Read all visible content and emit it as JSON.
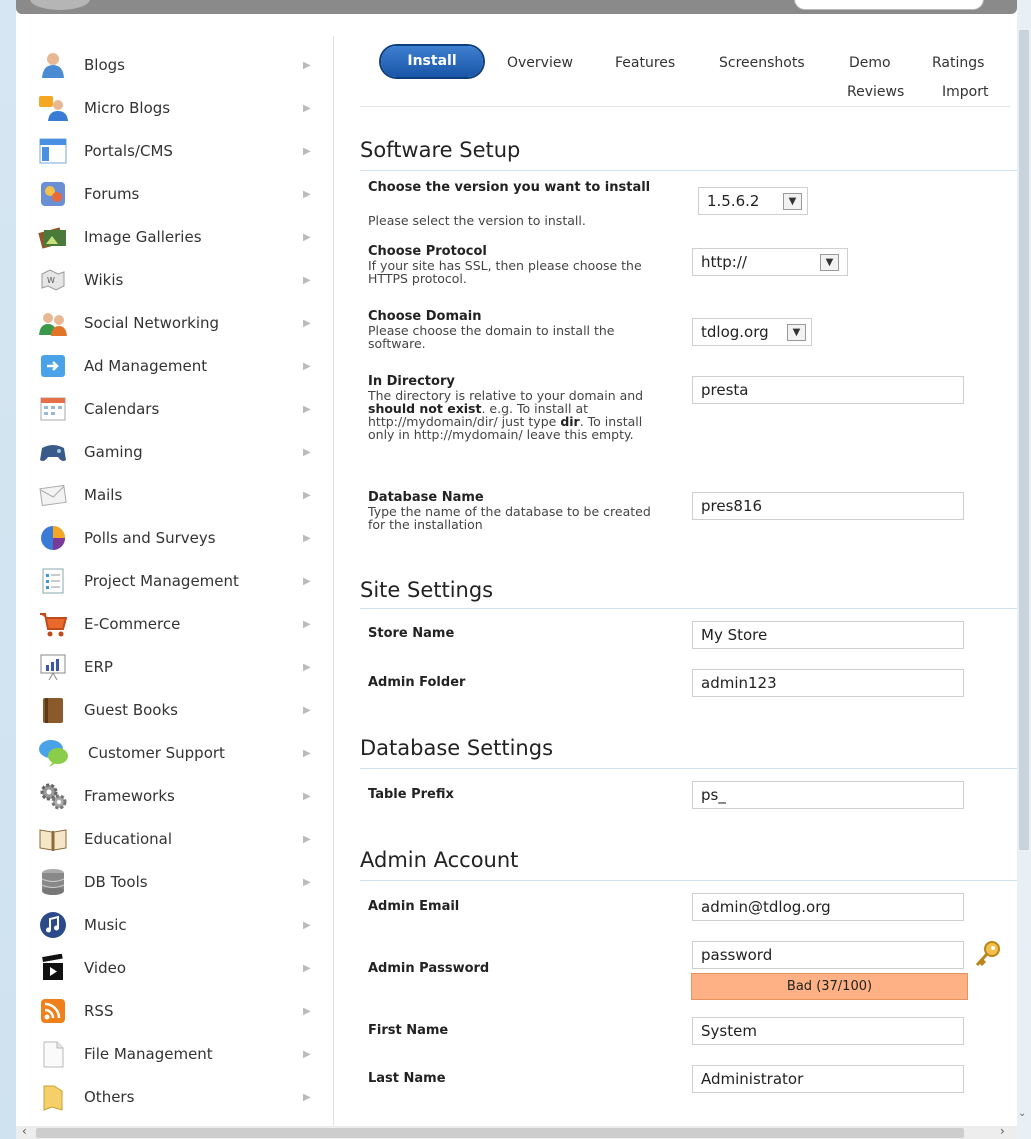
{
  "sidebar": {
    "categories": [
      {
        "label": "Blogs",
        "icon": "blogs-icon"
      },
      {
        "label": "Micro Blogs",
        "icon": "micro-blogs-icon"
      },
      {
        "label": "Portals/CMS",
        "icon": "portals-cms-icon"
      },
      {
        "label": "Forums",
        "icon": "forums-icon"
      },
      {
        "label": "Image Galleries",
        "icon": "image-galleries-icon"
      },
      {
        "label": "Wikis",
        "icon": "wikis-icon"
      },
      {
        "label": "Social Networking",
        "icon": "social-networking-icon"
      },
      {
        "label": "Ad Management",
        "icon": "ad-management-icon"
      },
      {
        "label": "Calendars",
        "icon": "calendars-icon"
      },
      {
        "label": "Gaming",
        "icon": "gaming-icon"
      },
      {
        "label": "Mails",
        "icon": "mails-icon"
      },
      {
        "label": "Polls and Surveys",
        "icon": "polls-icon"
      },
      {
        "label": "Project Management",
        "icon": "project-management-icon"
      },
      {
        "label": "E-Commerce",
        "icon": "cart-icon"
      },
      {
        "label": "ERP",
        "icon": "erp-icon"
      },
      {
        "label": "Guest Books",
        "icon": "guest-books-icon"
      },
      {
        "label": "Customer Support",
        "icon": "customer-support-icon"
      },
      {
        "label": "Frameworks",
        "icon": "gears-icon"
      },
      {
        "label": "Educational",
        "icon": "book-icon"
      },
      {
        "label": "DB Tools",
        "icon": "database-icon"
      },
      {
        "label": "Music",
        "icon": "music-icon"
      },
      {
        "label": "Video",
        "icon": "clapperboard-icon"
      },
      {
        "label": "RSS",
        "icon": "rss-icon"
      },
      {
        "label": "File Management",
        "icon": "file-icon"
      },
      {
        "label": "Others",
        "icon": "folder-icon"
      }
    ]
  },
  "tabs": {
    "install": "Install",
    "overview": "Overview",
    "features": "Features",
    "screenshots": "Screenshots",
    "demo": "Demo",
    "ratings": "Ratings",
    "reviews": "Reviews",
    "import": "Import"
  },
  "software_setup": {
    "title": "Software Setup",
    "version_label": "Choose the version you want to install",
    "version_desc": "Please select the version to install.",
    "version_value": "1.5.6.2",
    "protocol_label": "Choose Protocol",
    "protocol_desc": "If your site has SSL, then please choose the HTTPS protocol.",
    "protocol_value": "http://",
    "domain_label": "Choose Domain",
    "domain_desc": "Please choose the domain to install the software.",
    "domain_value": "tdlog.org",
    "directory_label": "In Directory",
    "directory_desc_1": "The directory is relative to your domain and ",
    "directory_desc_bold1": "should not exist",
    "directory_desc_2": ". e.g. To install at http://mydomain/dir/ just type ",
    "directory_desc_bold2": "dir",
    "directory_desc_3": ". To install only in http://mydomain/ leave this empty.",
    "directory_value": "presta",
    "dbname_label": "Database Name",
    "dbname_desc": "Type the name of the database to be created for the installation",
    "dbname_value": "pres816"
  },
  "site_settings": {
    "title": "Site Settings",
    "store_name_label": "Store Name",
    "store_name_value": "My Store",
    "admin_folder_label": "Admin Folder",
    "admin_folder_value": "admin123"
  },
  "database_settings": {
    "title": "Database Settings",
    "table_prefix_label": "Table Prefix",
    "table_prefix_value": "ps_"
  },
  "admin_account": {
    "title": "Admin Account",
    "email_label": "Admin Email",
    "email_value": "admin@tdlog.org",
    "password_label": "Admin Password",
    "password_value": "password",
    "strength_text": "Bad (37/100)",
    "strength_color": "#fdb184",
    "first_name_label": "First Name",
    "first_name_value": "System",
    "last_name_label": "Last Name",
    "last_name_value": "Administrator"
  },
  "colors": {
    "install_tab": "#1a56a8",
    "section_line": "#cfe0ee"
  }
}
